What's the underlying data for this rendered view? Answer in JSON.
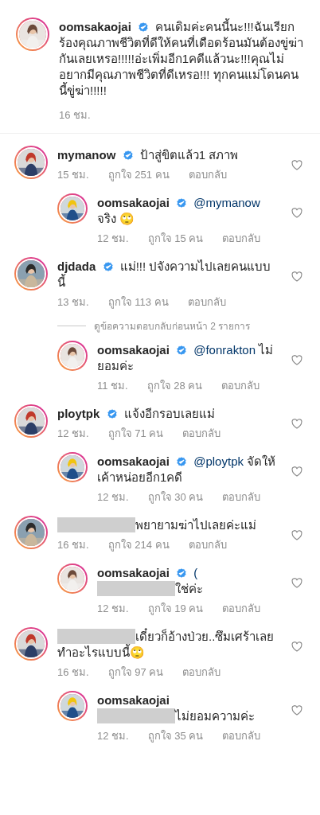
{
  "caption": {
    "parts": [
      {
        "kind": "username",
        "text": "oomsakaojai"
      },
      {
        "kind": "verified"
      },
      {
        "kind": "text",
        "text": "คนเดิมค่ะคนนี้นะ!!!ฉันเรียกร้องคุณภาพชีวิตที่ดีให้คนที่เดือดร้อนมันต้องขู่ฆ่ากันเลยเหรอ!!!!!อ่ะเพิ่มอีก1คดีแล้วนะ!!!คุณไม่อยากมีคุณภาพชีวิตที่ดีเหรอ!!! ทุกคนแม่โดนคนนี้ขู่ฆ่า!!!!!"
      }
    ],
    "time": "16 ชม."
  },
  "comments": [
    {
      "kind": "comment",
      "parts": [
        {
          "kind": "username",
          "text": "mymanow"
        },
        {
          "kind": "verified"
        },
        {
          "kind": "text",
          "text": "ป้าสู่ขิตแล้ว1 สภาพ"
        }
      ],
      "time": "15 ชม.",
      "likes": "ถูกใจ 251 คน",
      "reply": "ตอบกลับ"
    },
    {
      "kind": "reply",
      "parts": [
        {
          "kind": "username",
          "text": "oomsakaojai"
        },
        {
          "kind": "verified"
        },
        {
          "kind": "mention",
          "text": "@mymanow"
        },
        {
          "kind": "text",
          "text": "จริง 🙄"
        }
      ],
      "time": "12 ชม.",
      "likes": "ถูกใจ 15 คน",
      "reply": "ตอบกลับ"
    },
    {
      "kind": "comment",
      "parts": [
        {
          "kind": "username",
          "text": "djdada"
        },
        {
          "kind": "verified"
        },
        {
          "kind": "text",
          "text": "แม่!!! ปจังความไปเลยคนแบบนี้"
        }
      ],
      "time": "13 ชม.",
      "likes": "ถูกใจ 113 คน",
      "reply": "ตอบกลับ"
    },
    {
      "kind": "view_replies",
      "text": "ดูข้อความตอบกลับก่อนหน้า 2 รายการ"
    },
    {
      "kind": "reply",
      "parts": [
        {
          "kind": "username",
          "text": "oomsakaojai"
        },
        {
          "kind": "verified"
        },
        {
          "kind": "mention",
          "text": "@fonrakton"
        },
        {
          "kind": "text",
          "text": "ไม่ยอมค่ะ"
        }
      ],
      "time": "11 ชม.",
      "likes": "ถูกใจ 28 คน",
      "reply": "ตอบกลับ"
    },
    {
      "kind": "comment",
      "parts": [
        {
          "kind": "username",
          "text": "ploytpk"
        },
        {
          "kind": "verified"
        },
        {
          "kind": "text",
          "text": "แจ้งอีกรอบเลยแม่"
        }
      ],
      "time": "12 ชม.",
      "likes": "ถูกใจ 71 คน",
      "reply": "ตอบกลับ"
    },
    {
      "kind": "reply",
      "parts": [
        {
          "kind": "username",
          "text": "oomsakaojai"
        },
        {
          "kind": "verified"
        },
        {
          "kind": "mention",
          "text": "@ploytpk"
        },
        {
          "kind": "text",
          "text": "จัดให้เค้าหน่อยอีก1คดี"
        }
      ],
      "time": "12 ชม.",
      "likes": "ถูกใจ 30 คน",
      "reply": "ตอบกลับ"
    },
    {
      "kind": "comment",
      "parts": [
        {
          "kind": "redacted"
        },
        {
          "kind": "text",
          "text": "พยายามฆ่าไปเลยค่ะแม่"
        }
      ],
      "time": "16 ชม.",
      "likes": "ถูกใจ 214 คน",
      "reply": "ตอบกลับ"
    },
    {
      "kind": "reply",
      "parts": [
        {
          "kind": "username",
          "text": "oomsakaojai"
        },
        {
          "kind": "verified"
        },
        {
          "kind": "mention",
          "text": "("
        },
        {
          "kind": "redacted"
        },
        {
          "kind": "text",
          "text": "ใช่ค่ะ"
        }
      ],
      "time": "12 ชม.",
      "likes": "ถูกใจ 19 คน",
      "reply": "ตอบกลับ"
    },
    {
      "kind": "comment",
      "parts": [
        {
          "kind": "redacted"
        },
        {
          "kind": "text",
          "text": "เดี๋ยวก็อ้างป่วย..ซึมเศร้าเลยทำอะไรแบบนี้🙄"
        }
      ],
      "time": "16 ชม.",
      "likes": "ถูกใจ 97 คน",
      "reply": "ตอบกลับ"
    },
    {
      "kind": "reply",
      "parts": [
        {
          "kind": "username",
          "text": "oomsakaojai"
        },
        {
          "kind": "break"
        },
        {
          "kind": "redacted"
        },
        {
          "kind": "text",
          "text": "ไม่ยอมความค่ะ"
        }
      ],
      "time": "12 ชม.",
      "likes": "ถูกใจ 35 คน",
      "reply": "ตอบกลับ"
    }
  ]
}
